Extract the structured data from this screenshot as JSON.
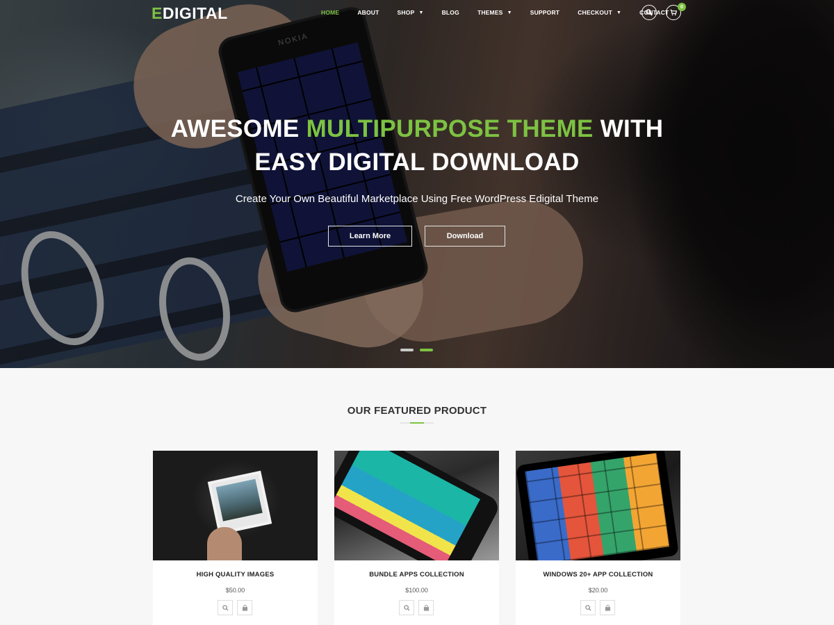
{
  "nav": {
    "logo_first": "E",
    "logo_rest": "DIGITAL",
    "items": [
      {
        "label": "HOME",
        "dropdown": false,
        "active": true
      },
      {
        "label": "ABOUT",
        "dropdown": false,
        "active": false
      },
      {
        "label": "SHOP",
        "dropdown": true,
        "active": false
      },
      {
        "label": "BLOG",
        "dropdown": false,
        "active": false
      },
      {
        "label": "THEMES",
        "dropdown": true,
        "active": false
      },
      {
        "label": "SUPPORT",
        "dropdown": false,
        "active": false
      },
      {
        "label": "CHECKOUT",
        "dropdown": true,
        "active": false
      },
      {
        "label": "CONTACT",
        "dropdown": false,
        "active": false
      }
    ],
    "cart_count": "0",
    "search_icon": "search-icon",
    "cart_icon": "cart-icon"
  },
  "hero": {
    "title_line1_part1": "AWESOME ",
    "title_line1_accent": "MULTIPURPOSE THEME",
    "title_line1_part2": " WITH",
    "title_line2": "EASY DIGITAL DOWNLOAD",
    "subtitle": "Create Your Own Beautiful Marketplace Using Free WordPress Edigital Theme",
    "learn_more": "Learn More",
    "download": "Download",
    "phone_brand": "NOKIA",
    "slide_count": 2,
    "active_slide": 2
  },
  "featured": {
    "title": "OUR FEATURED PRODUCT",
    "products": [
      {
        "name": "HIGH QUALITY IMAGES",
        "price": "$50.00"
      },
      {
        "name": "BUNDLE APPS COLLECTION",
        "price": "$100.00"
      },
      {
        "name": "WINDOWS 20+ APP COLLECTION",
        "price": "$20.00"
      }
    ]
  },
  "colors": {
    "accent": "#7dc242",
    "text_dark": "#333333",
    "background": "#f7f7f7"
  }
}
